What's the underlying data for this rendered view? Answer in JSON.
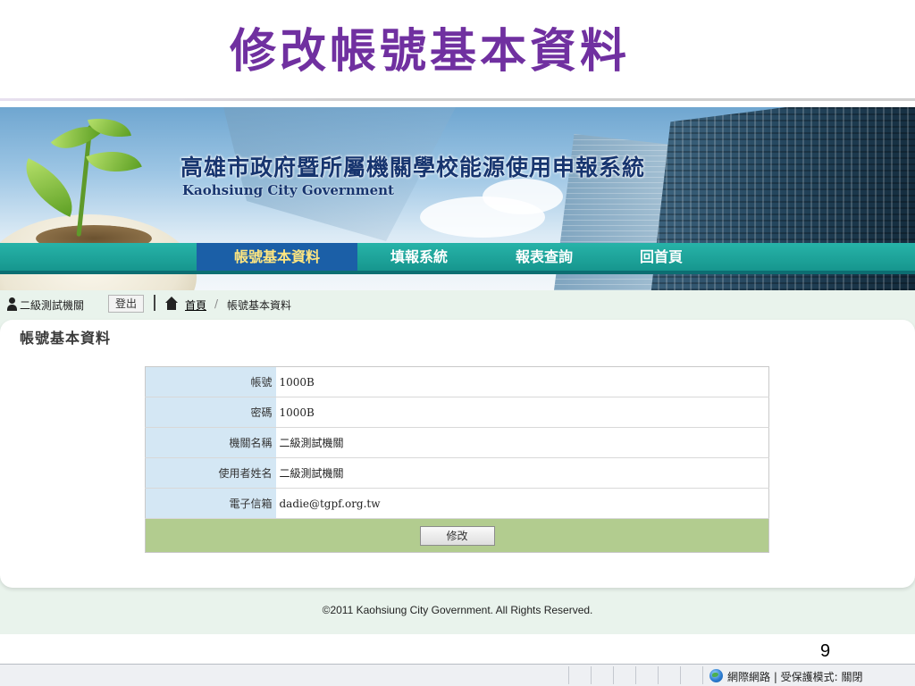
{
  "slide": {
    "title": "修改帳號基本資料",
    "page_number": "9"
  },
  "colors": {
    "title": "#7030a0",
    "nav_bg": "#16968e",
    "nav_active_bg": "#1b5fa7",
    "table_label_bg": "#d4e7f4",
    "table_action_bg": "#b2cc8f"
  },
  "banner": {
    "system_title": "高雄市政府暨所屬機關學校能源使用申報系統",
    "subtitle": "Kaohsiung City Government"
  },
  "nav": {
    "items": [
      {
        "label": "帳號基本資料",
        "active": true
      },
      {
        "label": "填報系統",
        "active": false
      },
      {
        "label": "報表查詢",
        "active": false
      },
      {
        "label": "回首頁",
        "active": false
      }
    ]
  },
  "userbar": {
    "username": "二級測試機關",
    "logout_label": "登出",
    "home_link": "首頁",
    "separator": "/",
    "current_page": "帳號基本資料"
  },
  "content": {
    "section_title": "帳號基本資料",
    "fields": [
      {
        "label": "帳號",
        "value": "1000B"
      },
      {
        "label": "密碼",
        "value": "1000B"
      },
      {
        "label": "機關名稱",
        "value": "二級測試機關"
      },
      {
        "label": "使用者姓名",
        "value": "二級測試機關"
      },
      {
        "label": "電子信箱",
        "value": "dadie@tgpf.org.tw"
      }
    ],
    "submit_label": "修改"
  },
  "footer": {
    "copyright": "©2011 Kaohsiung City Government. All Rights Reserved."
  },
  "statusbar": {
    "icon": "globe-icon",
    "text": "網際網路 | 受保護模式: 關閉"
  }
}
